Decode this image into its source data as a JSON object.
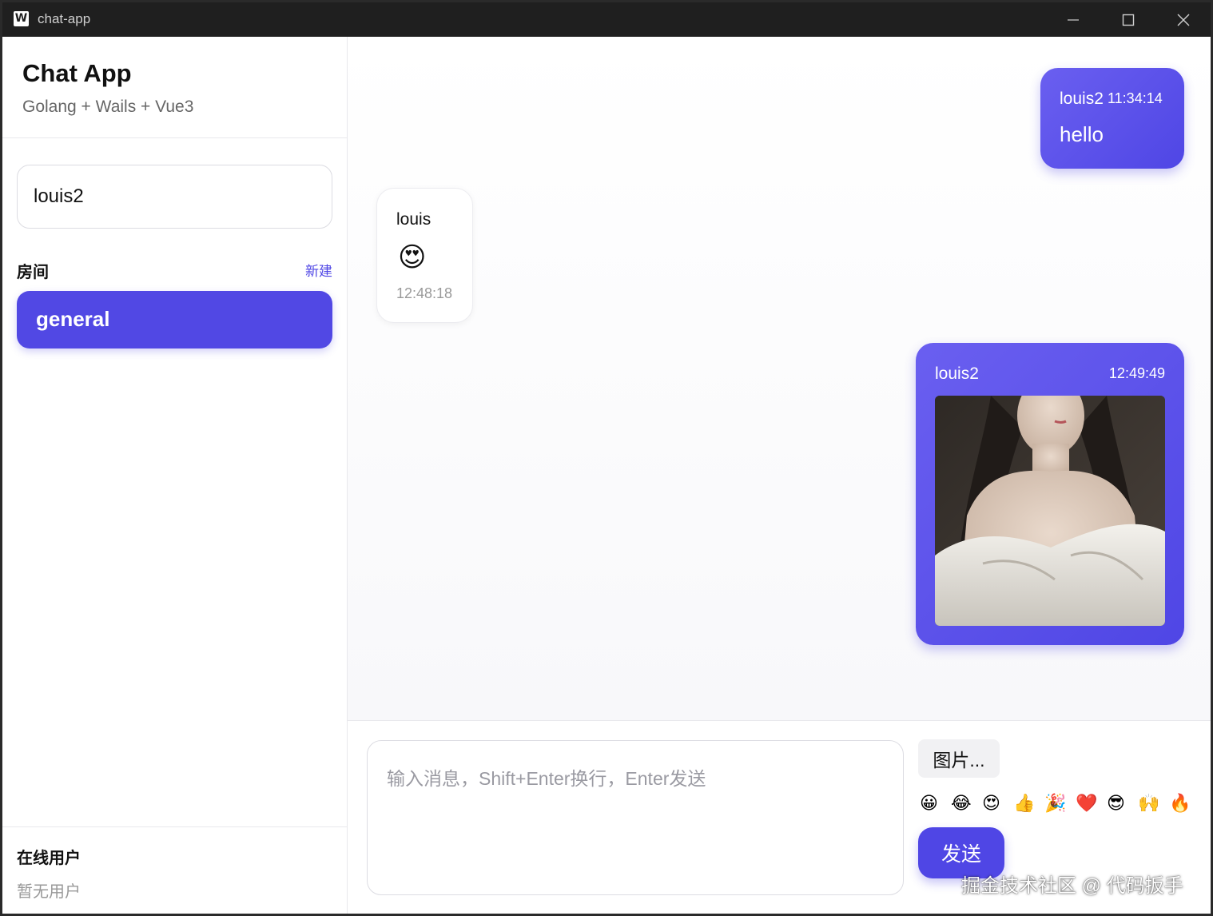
{
  "window": {
    "title": "chat-app",
    "app_icon": "W",
    "controls": [
      "minimize-icon",
      "maximize-icon",
      "close-icon"
    ]
  },
  "sidebar": {
    "title": "Chat App",
    "subtitle": "Golang + Wails + Vue3",
    "username_value": "louis2",
    "rooms_label": "房间",
    "new_room_label": "新建",
    "rooms": [
      {
        "label": "general",
        "active": true
      }
    ],
    "online_label": "在线用户",
    "online_empty": "暂无用户"
  },
  "messages": [
    {
      "user": "louis2",
      "time": "11:34:14",
      "text": "hello",
      "mine": true
    },
    {
      "user": "louis",
      "time": "12:48:18",
      "emoji": "😍",
      "mine": false
    },
    {
      "user": "louis2",
      "time": "12:49:49",
      "image": "photo-of-woman",
      "mine": true
    }
  ],
  "composer": {
    "placeholder": "输入消息，Shift+Enter换行，Enter发送",
    "image_button": "图片...",
    "emojis": [
      "😀",
      "😂",
      "😍",
      "👍",
      "🎉",
      "❤️",
      "😎",
      "🙌",
      "🔥"
    ],
    "send_label": "发送"
  },
  "watermark": "掘金技术社区 @ 代码扳手",
  "colors": {
    "accent": "#4f46e5",
    "titlebar": "#1f1f1f"
  }
}
